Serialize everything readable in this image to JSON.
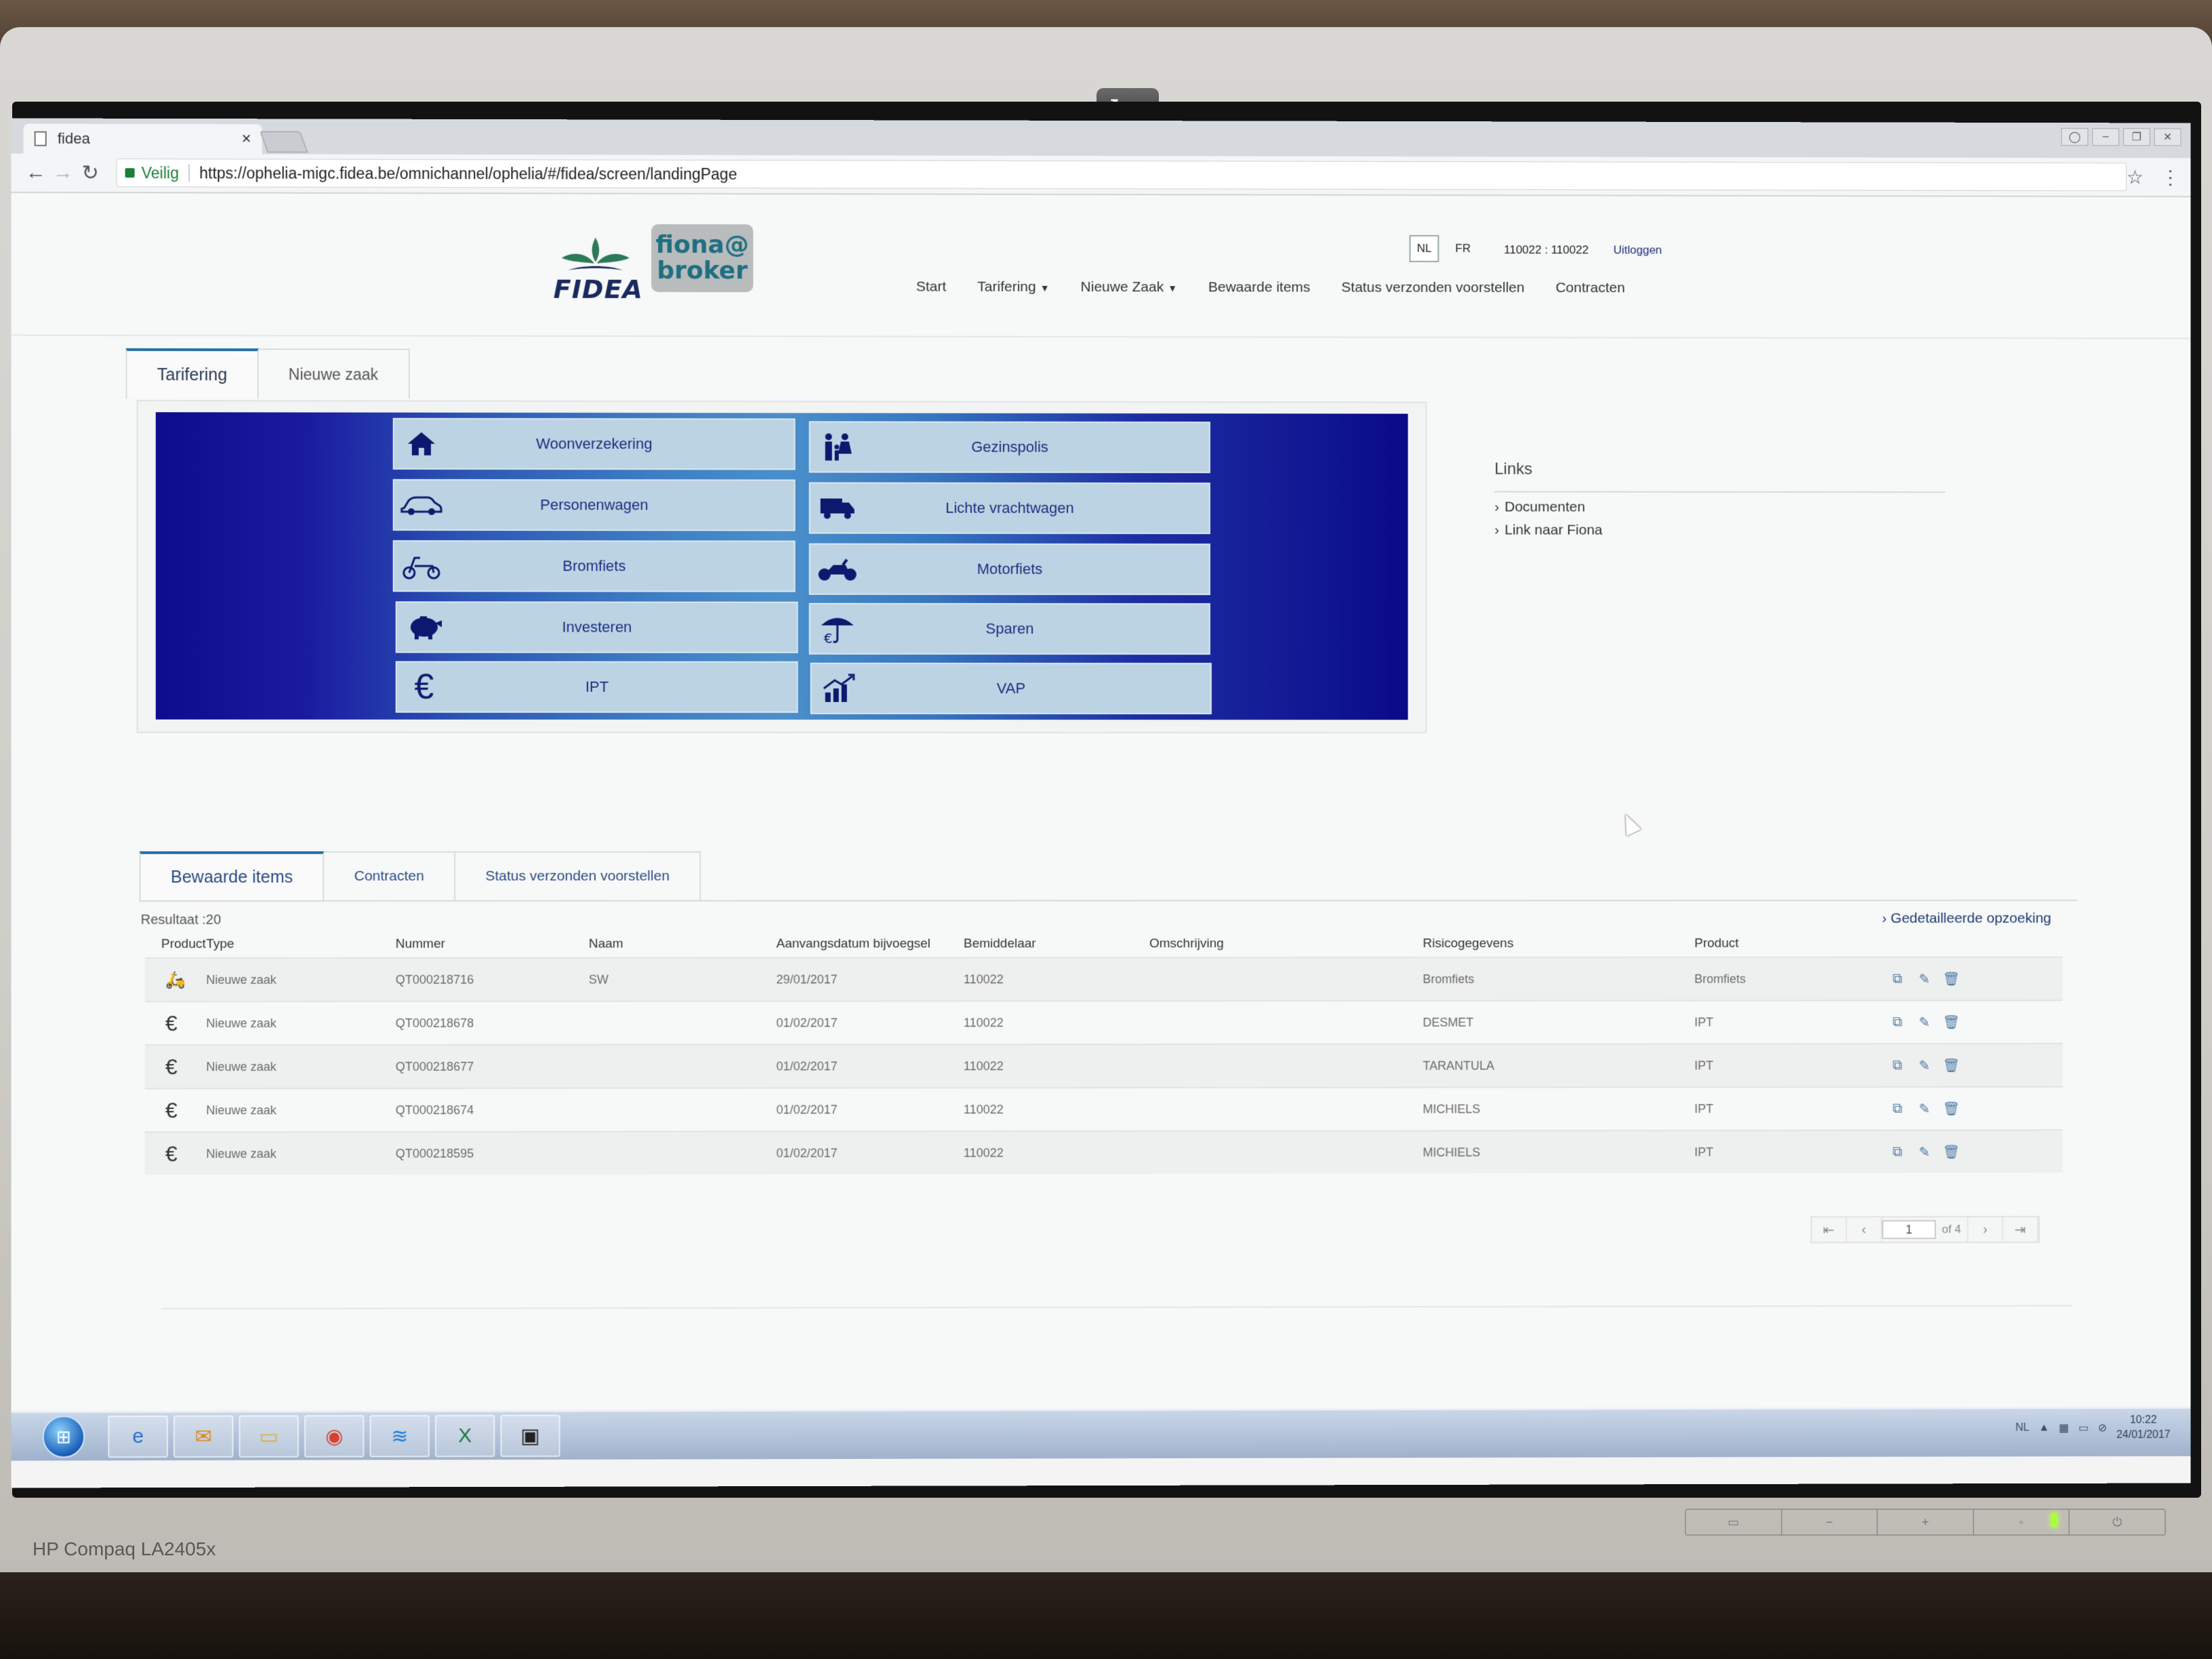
{
  "monitor": {
    "brand": "hp",
    "model": "HP Compaq LA2405x"
  },
  "browser": {
    "tab_title": "fidea",
    "tab_close": "×",
    "secure_label": "Veilig",
    "url": "https://ophelia-migc.fidea.be/omnichannel/ophelia/#/fidea/screen/landingPage"
  },
  "header": {
    "brand": "FIDEA",
    "portal_logo_line1": "fiona@",
    "portal_logo_line2": "broker",
    "lang_nl": "NL",
    "lang_fr": "FR",
    "user_id": "110022 : 110022",
    "logout": "Uitloggen",
    "nav": [
      "Start",
      "Tarifering",
      "Nieuwe Zaak",
      "Bewaarde items",
      "Status verzonden voorstellen",
      "Contracten"
    ]
  },
  "top_tabs": [
    "Tarifering",
    "Nieuwe zaak"
  ],
  "tiles": [
    {
      "label": "Woonverzekering",
      "icon": "house-icon"
    },
    {
      "label": "Gezinspolis",
      "icon": "family-icon"
    },
    {
      "label": "Personenwagen",
      "icon": "car-icon"
    },
    {
      "label": "Lichte vrachtwagen",
      "icon": "truck-icon"
    },
    {
      "label": "Bromfiets",
      "icon": "scooter-icon"
    },
    {
      "label": "Motorfiets",
      "icon": "motorcycle-icon"
    },
    {
      "label": "Investeren",
      "icon": "piggy-bank-icon"
    },
    {
      "label": "Sparen",
      "icon": "umbrella-euro-icon"
    },
    {
      "label": "IPT",
      "icon": "euro-icon"
    },
    {
      "label": "VAP",
      "icon": "growth-chart-icon"
    }
  ],
  "links": {
    "title": "Links",
    "items": [
      "Documenten",
      "Link naar Fiona"
    ]
  },
  "bottom_tabs": [
    "Bewaarde items",
    "Contracten",
    "Status verzonden voorstellen"
  ],
  "results": {
    "label": "Resultaat :20",
    "detail_link": "Gedetailleerde opzoeking",
    "columns": [
      "Product",
      "Type",
      "Nummer",
      "Naam",
      "Aanvangsdatum bijvoegsel",
      "Bemiddelaar",
      "Omschrijving",
      "Risicogegevens",
      "Product"
    ],
    "rows": [
      {
        "icon": "scooter-icon",
        "type": "Nieuwe zaak",
        "nummer": "QT000218716",
        "naam": "SW",
        "datum": "29/01/2017",
        "bemiddelaar": "110022",
        "omschrijving": "",
        "risico": "Bromfiets",
        "product": "Bromfiets"
      },
      {
        "icon": "euro-icon",
        "type": "Nieuwe zaak",
        "nummer": "QT000218678",
        "naam": "",
        "datum": "01/02/2017",
        "bemiddelaar": "110022",
        "omschrijving": "",
        "risico": "DESMET",
        "product": "IPT"
      },
      {
        "icon": "euro-icon",
        "type": "Nieuwe zaak",
        "nummer": "QT000218677",
        "naam": "",
        "datum": "01/02/2017",
        "bemiddelaar": "110022",
        "omschrijving": "",
        "risico": "TARANTULA",
        "product": "IPT"
      },
      {
        "icon": "euro-icon",
        "type": "Nieuwe zaak",
        "nummer": "QT000218674",
        "naam": "",
        "datum": "01/02/2017",
        "bemiddelaar": "110022",
        "omschrijving": "",
        "risico": "MICHIELS",
        "product": "IPT"
      },
      {
        "icon": "euro-icon",
        "type": "Nieuwe zaak",
        "nummer": "QT000218595",
        "naam": "",
        "datum": "01/02/2017",
        "bemiddelaar": "110022",
        "omschrijving": "",
        "risico": "MICHIELS",
        "product": "IPT"
      }
    ]
  },
  "pager": {
    "current": "1",
    "of_label": "of 4"
  },
  "taskbar": {
    "lang": "NL",
    "time": "10:22",
    "date": "24/01/2017"
  },
  "colors": {
    "tile_panel_edge": "#0c0c8c",
    "tile_bg": "#bcd3e3",
    "accent_text": "#1a2f82",
    "secure": "#1a7f37"
  }
}
